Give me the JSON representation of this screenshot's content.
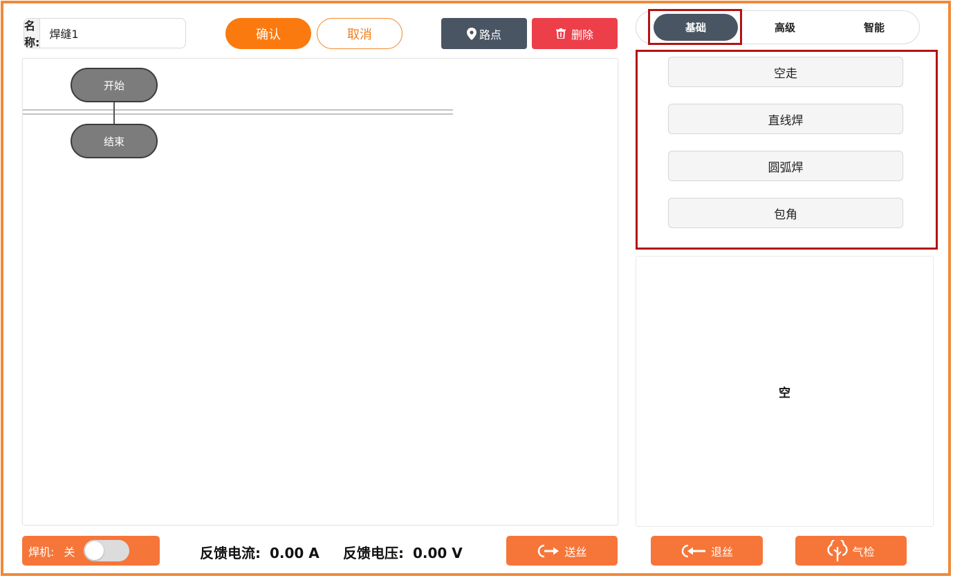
{
  "header": {
    "name_label": "名称:",
    "name_value": "焊缝1",
    "confirm_label": "确认",
    "cancel_label": "取消",
    "waypoint_label": "路点",
    "delete_label": "删除"
  },
  "flow": {
    "start_label": "开始",
    "end_label": "结束"
  },
  "tabs": [
    {
      "label": "基础",
      "active": true
    },
    {
      "label": "高级",
      "active": false
    },
    {
      "label": "智能",
      "active": false
    }
  ],
  "basic_ops": [
    {
      "label": "空走"
    },
    {
      "label": "直线焊"
    },
    {
      "label": "圆弧焊"
    },
    {
      "label": "包角"
    }
  ],
  "detail_panel": {
    "empty_text": "空"
  },
  "bottom": {
    "welder_label": "焊机:",
    "welder_state": "关",
    "current_label": "反馈电流:",
    "current_value": "0.00 A",
    "voltage_label": "反馈电压:",
    "voltage_value": "0.00 V",
    "feed_label": "送丝",
    "retract_label": "退丝",
    "gas_label": "气检"
  },
  "colors": {
    "accent_orange": "#fb7a10",
    "button_orange": "#f6763a",
    "dark_slate": "#4a5563",
    "danger_red": "#ec3f4a",
    "highlight_red": "#b31212",
    "frame_orange": "#ef8a3a"
  }
}
